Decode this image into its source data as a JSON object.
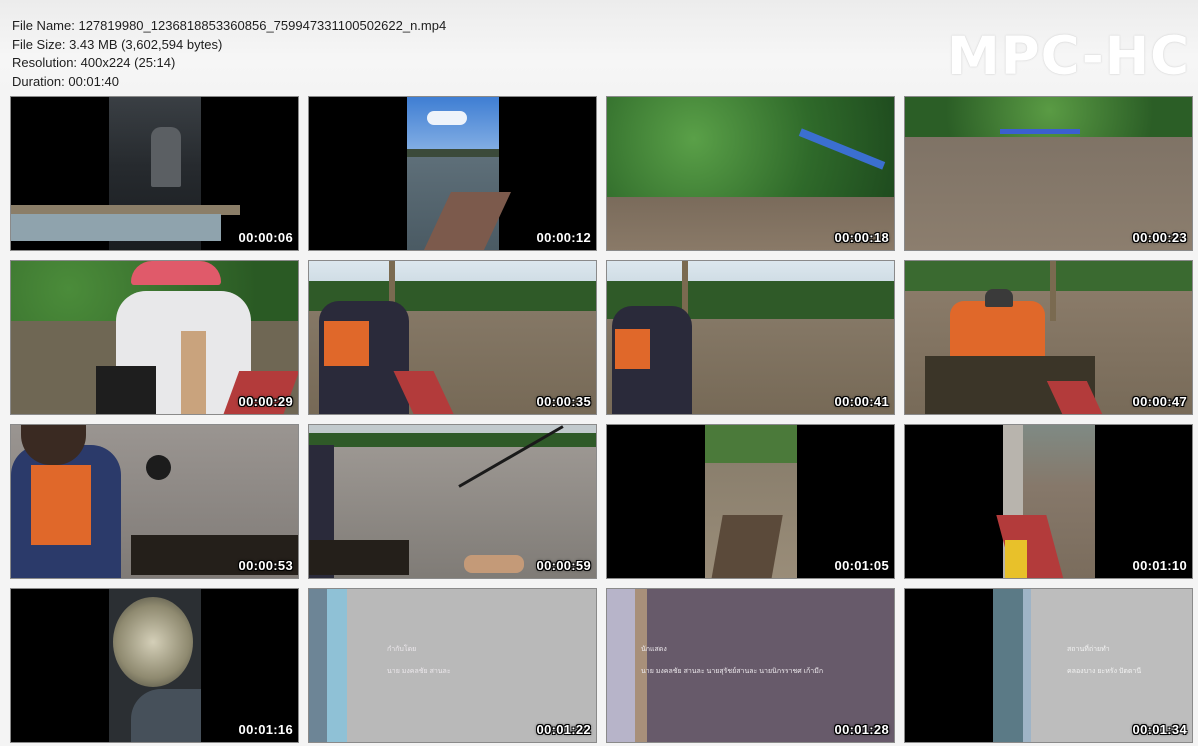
{
  "info": {
    "file_name": "File Name: 127819980_1236818853360856_759947331100502622_n.mp4",
    "file_size": "File Size: 3.43 MB (3,602,594 bytes)",
    "resolution": "Resolution: 400x224 (25:14)",
    "duration": "Duration: 00:01:40"
  },
  "logo": "MPC-HC",
  "thumbnails": [
    {
      "time": "00:00:06"
    },
    {
      "time": "00:00:12"
    },
    {
      "time": "00:00:18"
    },
    {
      "time": "00:00:23"
    },
    {
      "time": "00:00:29"
    },
    {
      "time": "00:00:35"
    },
    {
      "time": "00:00:41"
    },
    {
      "time": "00:00:47"
    },
    {
      "time": "00:00:53"
    },
    {
      "time": "00:00:59"
    },
    {
      "time": "00:01:05"
    },
    {
      "time": "00:01:10"
    },
    {
      "time": "00:01:16"
    },
    {
      "time": "00:01:22",
      "caption_1": "กำกับโดย",
      "caption_2": "นาย มงคลชัย สานละ"
    },
    {
      "time": "00:01:28",
      "caption_1": "นักแสดง",
      "caption_2": "นาย มงคลชัย สานละ นายสุรัชย์สานละ นายนิกรราชศ เก้ามีก"
    },
    {
      "time": "00:01:34",
      "caption_1": "สถานที่ถ่ายทำ",
      "caption_2": "คลองบาง ยะหรัง ปัตตานี"
    }
  ],
  "colors": {
    "river": "#7f6f5c",
    "foliage": "#2f6a2a",
    "shirt_orange": "#e0682a",
    "credits_gray": "#b9b9b9",
    "credits_purple": "#675a6a"
  }
}
